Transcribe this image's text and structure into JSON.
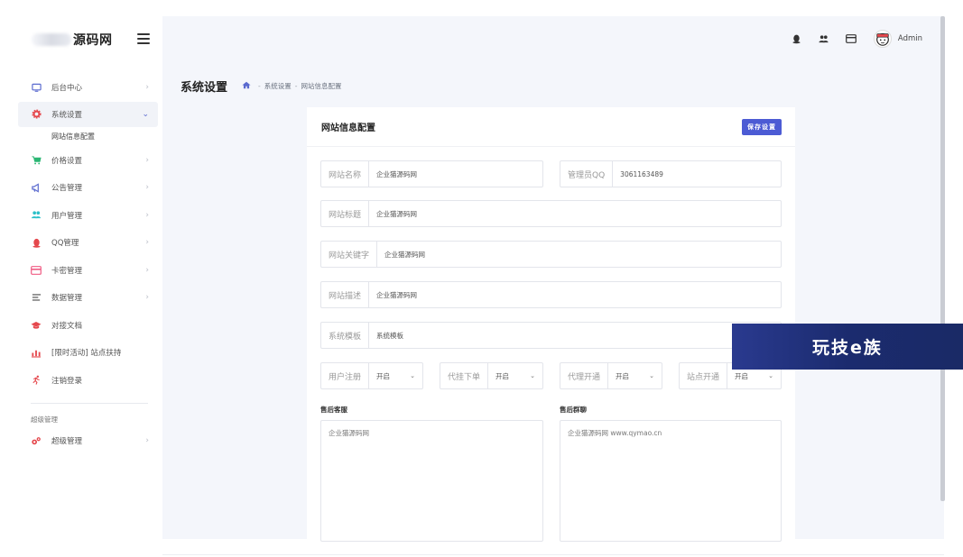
{
  "brand": {
    "name": "源码网"
  },
  "sidebar": {
    "items": [
      {
        "label": "后台中心",
        "icon": "monitor-icon",
        "color": "#5a6acf"
      },
      {
        "label": "系统设置",
        "icon": "gear-icon",
        "color": "#e5484d",
        "active": true
      },
      {
        "label": "价格设置",
        "icon": "cart-icon",
        "color": "#2bb673"
      },
      {
        "label": "公告管理",
        "icon": "megaphone-icon",
        "color": "#5a6acf"
      },
      {
        "label": "用户管理",
        "icon": "users-icon",
        "color": "#2bc0c8"
      },
      {
        "label": "QQ管理",
        "icon": "qq-icon",
        "color": "#e5484d"
      },
      {
        "label": "卡密管理",
        "icon": "card-icon",
        "color": "#f05c84"
      },
      {
        "label": "数据管理",
        "icon": "list-icon",
        "color": "#555555"
      },
      {
        "label": "对接文档",
        "icon": "graduation-cap-icon",
        "color": "#e5484d"
      },
      {
        "label": "[限时活动] 站点扶持",
        "icon": "bar-chart-icon",
        "color": "#e5484d"
      },
      {
        "label": "注销登录",
        "icon": "runner-icon",
        "color": "#e5484d"
      }
    ],
    "sub_item": "网站信息配置",
    "section_label": "超级管理",
    "super_item": {
      "label": "超级管理",
      "icon": "gears-icon",
      "color": "#e5484d"
    }
  },
  "topbar": {
    "admin_name": "Admin"
  },
  "page": {
    "title": "系统设置",
    "breadcrumb": [
      "系统设置",
      "网站信息配置"
    ]
  },
  "card": {
    "title": "网站信息配置",
    "save_label": "保存设置",
    "fields": {
      "site_name": {
        "label": "网站名称",
        "value": "企业猫源码网"
      },
      "admin_qq": {
        "label": "管理员QQ",
        "value": "3061163489"
      },
      "site_title": {
        "label": "网站标题",
        "value": "企业猫源码网"
      },
      "keywords": {
        "label": "网站关键字",
        "value": "企业猫源码网"
      },
      "description": {
        "label": "网站描述",
        "value": "企业猫源码网"
      },
      "template": {
        "label": "系统模板",
        "value": "系统模板"
      }
    },
    "selects": [
      {
        "label": "用户注册",
        "value": "开启"
      },
      {
        "label": "代挂下单",
        "value": "开启"
      },
      {
        "label": "代理开通",
        "value": "开启"
      },
      {
        "label": "站点开通",
        "value": "开启"
      }
    ],
    "after_sales_service": {
      "label": "售后客服",
      "value": "企业猫源码网"
    },
    "after_sales_group": {
      "label": "售后群聊",
      "value": "企业猫源码网 www.qymao.cn"
    }
  },
  "watermark": {
    "text": "玩技e族"
  }
}
